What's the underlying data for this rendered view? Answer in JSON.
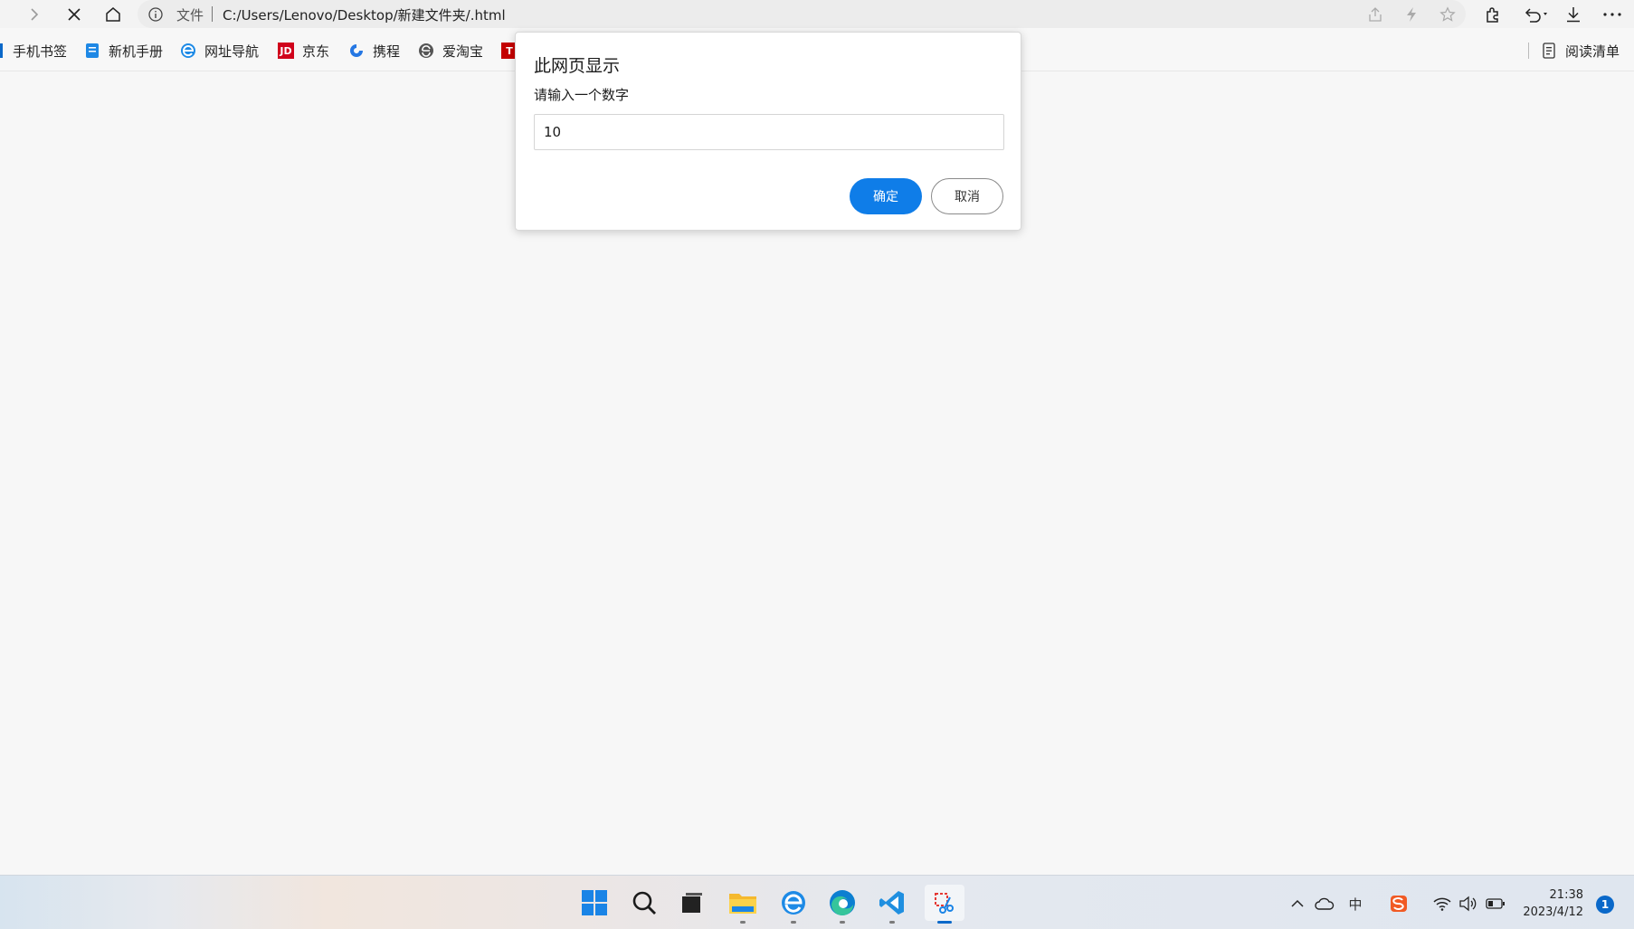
{
  "browser": {
    "address_bar": {
      "info_icon": "info-circle-icon",
      "file_label": "文件",
      "url": "C:/Users/Lenovo/Desktop/新建文件夹/.html"
    },
    "nav": [
      "forward-icon",
      "stop-icon",
      "home-icon"
    ],
    "address_actions": [
      "share-icon",
      "lightning-icon",
      "favorite-star-icon"
    ],
    "toolbar": [
      "extensions-icon",
      "undo-icon",
      "download-icon",
      "more-icon"
    ]
  },
  "bookmarks": {
    "items": [
      {
        "label": "手机书签",
        "icon": "folder-icon"
      },
      {
        "label": "新机手册",
        "icon": "document-icon"
      },
      {
        "label": "网址导航",
        "icon": "ie-icon"
      },
      {
        "label": "京东",
        "icon": "jd-icon",
        "icon_text": "JD"
      },
      {
        "label": "携程",
        "icon": "ctrip-icon"
      },
      {
        "label": "爱淘宝",
        "icon": "aitaobao-icon"
      },
      {
        "label": "",
        "icon": "tmall-icon",
        "icon_text": "T"
      }
    ],
    "reading_list": "阅读清单"
  },
  "dialog": {
    "title": "此网页显示",
    "message": "请输入一个数字",
    "input_value": "10",
    "ok_label": "确定",
    "cancel_label": "取消"
  },
  "taskbar": {
    "apps": [
      "start-icon",
      "search-icon",
      "task-view-icon",
      "file-explorer-icon",
      "ie-icon",
      "edge-icon",
      "vscode-icon",
      "snipping-tool-icon"
    ],
    "active_app": "snipping-tool-icon",
    "tray": [
      "chevron-up-icon",
      "onedrive-icon",
      "ime-icon",
      "sogou-icon",
      "wifi-icon",
      "volume-icon",
      "battery-icon"
    ],
    "ime_label": "中",
    "time": "21:38",
    "date": "2023/4/12",
    "notifications": "1"
  },
  "colors": {
    "accent": "#0f7de8",
    "jd_red": "#d0021b",
    "taskbar_active": "#0a68c9"
  }
}
